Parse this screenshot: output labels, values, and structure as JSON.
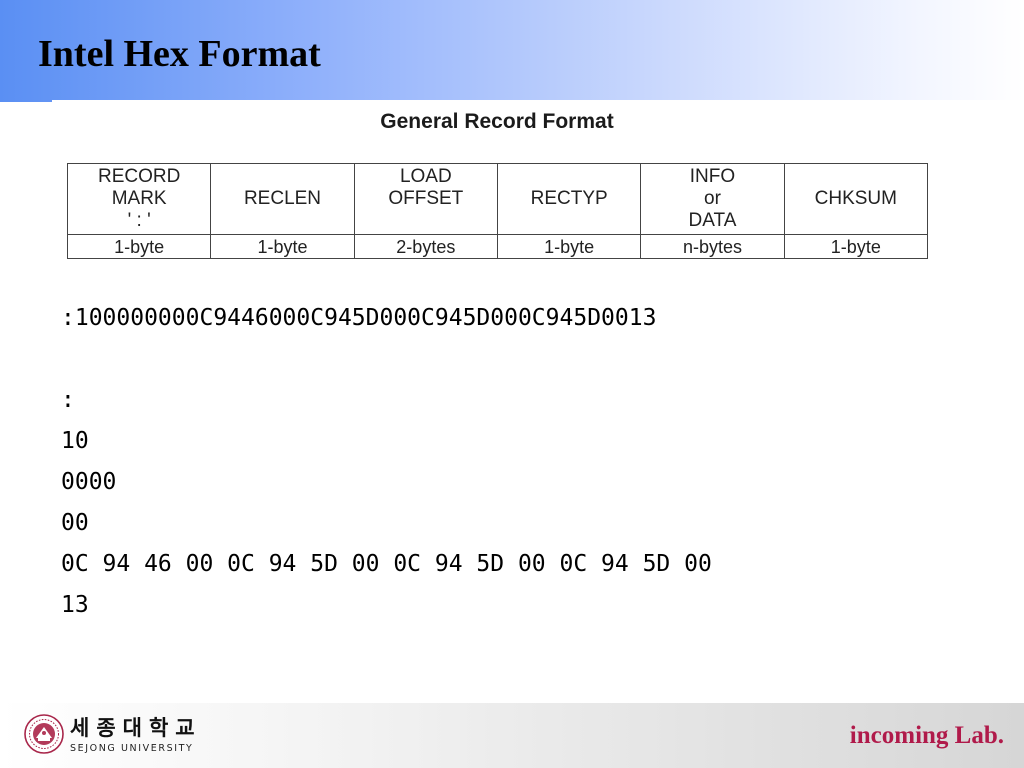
{
  "slide": {
    "title": "Intel Hex Format"
  },
  "figure": {
    "title": "General Record Format",
    "columns": [
      {
        "lines": [
          "RECORD",
          "MARK",
          "' : '"
        ],
        "size": "1-byte"
      },
      {
        "lines": [
          "RECLEN"
        ],
        "size": "1-byte"
      },
      {
        "lines": [
          "LOAD",
          "OFFSET"
        ],
        "size": "2-bytes"
      },
      {
        "lines": [
          "RECTYP"
        ],
        "size": "1-byte"
      },
      {
        "lines": [
          "INFO",
          "or",
          "DATA"
        ],
        "size": "n-bytes"
      },
      {
        "lines": [
          "CHKSUM"
        ],
        "size": "1-byte"
      }
    ]
  },
  "example": {
    "record": ":100000000C9446000C945D000C945D000C945D0013",
    "parts": [
      ":",
      "10",
      "0000",
      "00",
      "0C 94 46 00 0C 94 5D 00 0C 94 5D 00 0C 94 5D 00",
      "13"
    ]
  },
  "footer": {
    "university_korean": "세종대학교",
    "university_english": "SEJONG UNIVERSITY",
    "lab": "incoming Lab."
  },
  "colors": {
    "header_blue": "#5a8ff3",
    "lab_text": "#b01a4a"
  }
}
